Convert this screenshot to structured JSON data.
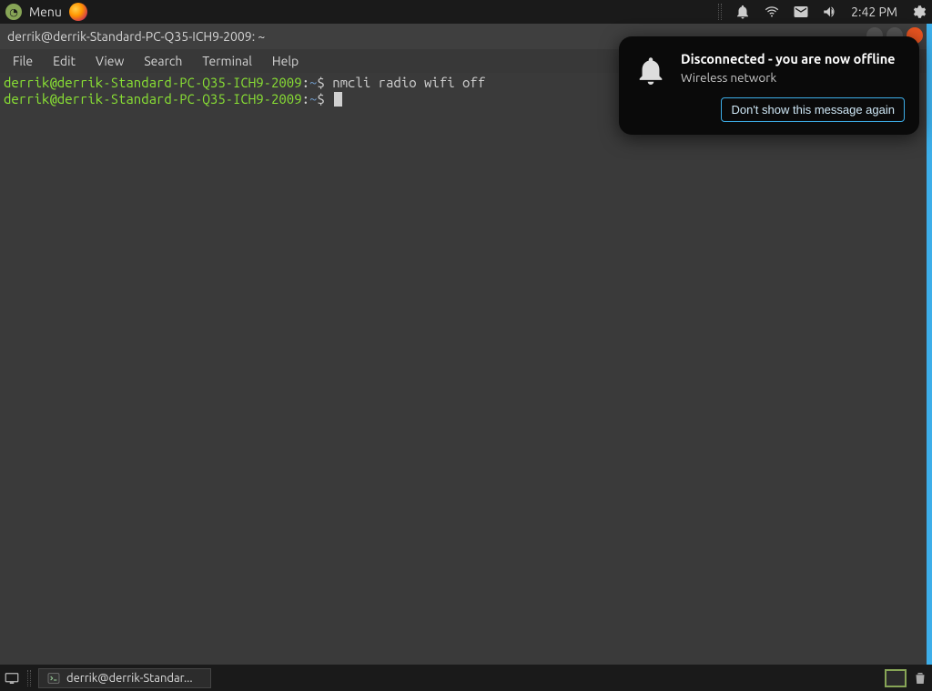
{
  "top_panel": {
    "menu_label": "Menu",
    "clock": "2:42 PM"
  },
  "terminal": {
    "title": "derrik@derrik-Standard-PC-Q35-ICH9-2009: ~",
    "menubar": {
      "file": "File",
      "edit": "Edit",
      "view": "View",
      "search": "Search",
      "terminal": "Terminal",
      "help": "Help"
    },
    "lines": {
      "l1_prompt": "derrik@derrik-Standard-PC-Q35-ICH9-2009",
      "l1_sep": ":",
      "l1_path": "~",
      "l1_dollar": "$ ",
      "l1_cmd": "nmcli radio wifi off",
      "l2_prompt": "derrik@derrik-Standard-PC-Q35-ICH9-2009",
      "l2_sep": ":",
      "l2_path": "~",
      "l2_dollar": "$ "
    }
  },
  "notification": {
    "title": "Disconnected - you are now offline",
    "subtitle": "Wireless network",
    "button": "Don't show this message again"
  },
  "taskbar": {
    "window_title": "derrik@derrik-Standar..."
  }
}
